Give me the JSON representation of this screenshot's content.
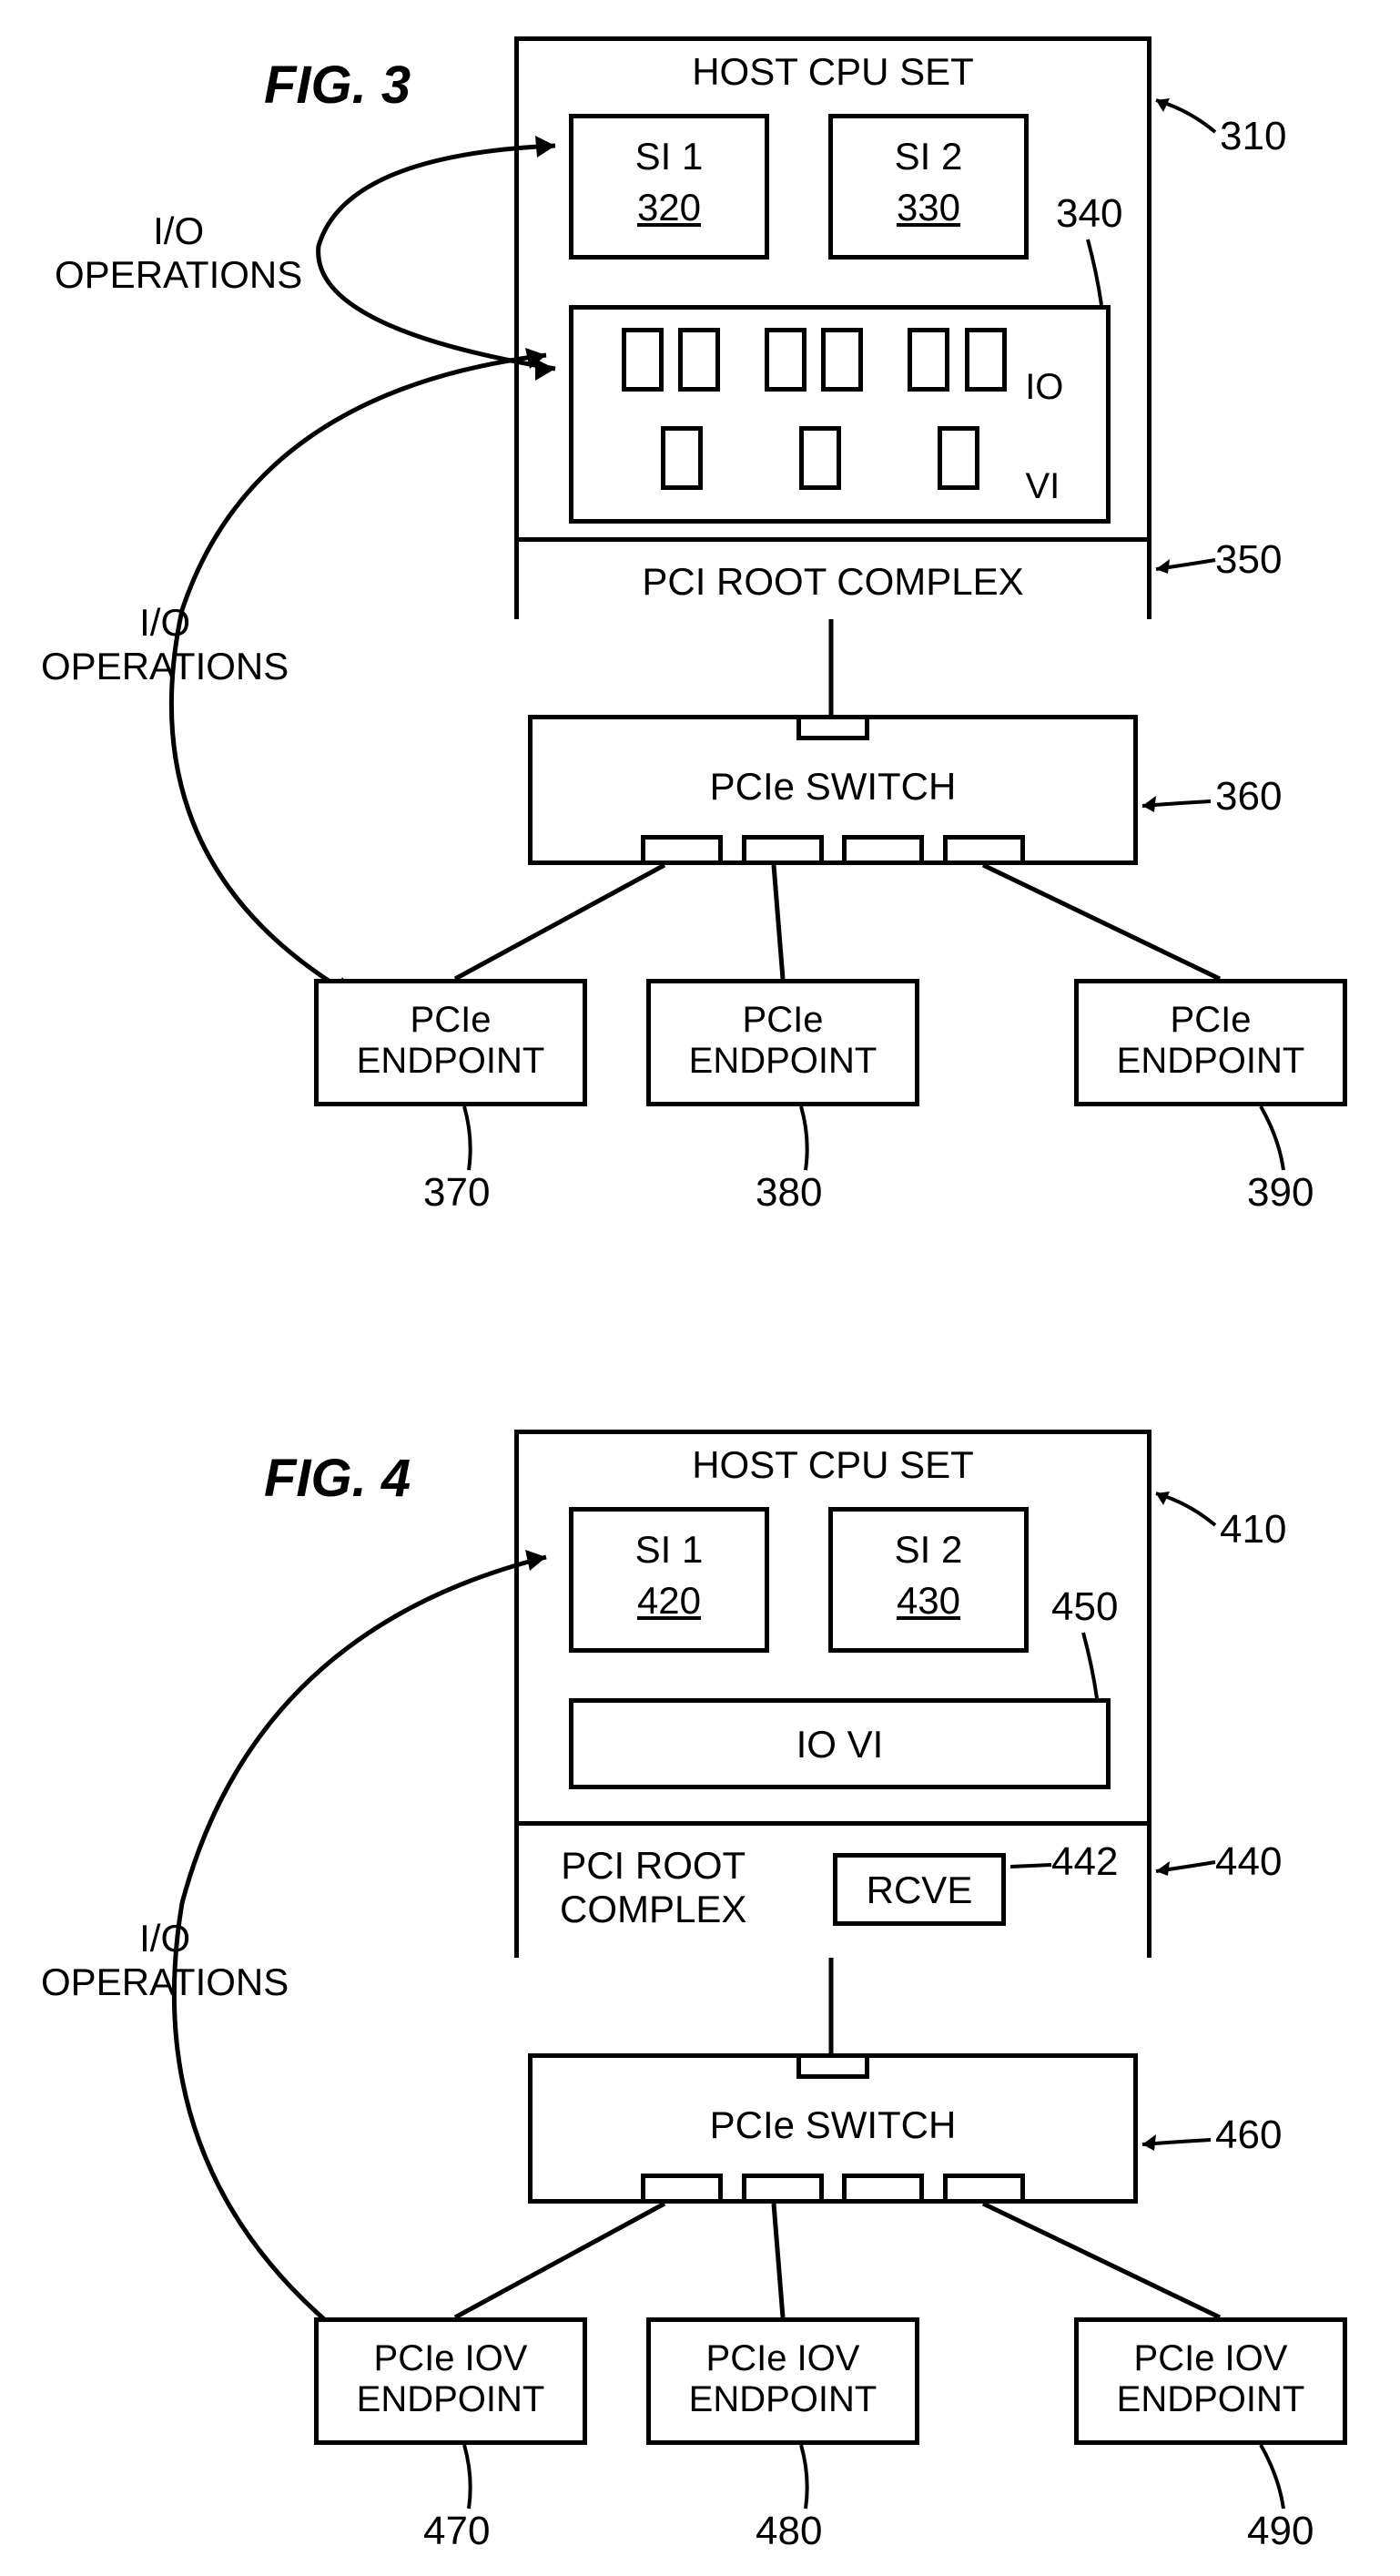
{
  "fig3": {
    "title": "FIG. 3",
    "host_title": "HOST CPU SET",
    "si1_label": "SI 1",
    "si1_num": "320",
    "si2_label": "SI 2",
    "si2_num": "330",
    "io_label": "IO",
    "vi_label": "VI",
    "root_complex": "PCI ROOT COMPLEX",
    "switch": "PCIe SWITCH",
    "endpoint1": "PCIe",
    "endpoint1b": "ENDPOINT",
    "endpoint2": "PCIe",
    "endpoint2b": "ENDPOINT",
    "endpoint3": "PCIe",
    "endpoint3b": "ENDPOINT",
    "io_ops1": "I/O",
    "io_ops2": "OPERATIONS",
    "ref310": "310",
    "ref340": "340",
    "ref350": "350",
    "ref360": "360",
    "ref370": "370",
    "ref380": "380",
    "ref390": "390"
  },
  "fig4": {
    "title": "FIG. 4",
    "host_title": "HOST CPU SET",
    "si1_label": "SI 1",
    "si1_num": "420",
    "si2_label": "SI 2",
    "si2_num": "430",
    "iovi_label": "IO  VI",
    "root_complex": "PCI ROOT",
    "root_complex2": "COMPLEX",
    "rcve": "RCVE",
    "switch": "PCIe SWITCH",
    "endpoint1": "PCIe IOV",
    "endpoint1b": "ENDPOINT",
    "endpoint2": "PCIe IOV",
    "endpoint2b": "ENDPOINT",
    "endpoint3": "PCIe IOV",
    "endpoint3b": "ENDPOINT",
    "io_ops1": "I/O",
    "io_ops2": "OPERATIONS",
    "ref410": "410",
    "ref440": "440",
    "ref442": "442",
    "ref450": "450",
    "ref460": "460",
    "ref470": "470",
    "ref480": "480",
    "ref490": "490"
  }
}
